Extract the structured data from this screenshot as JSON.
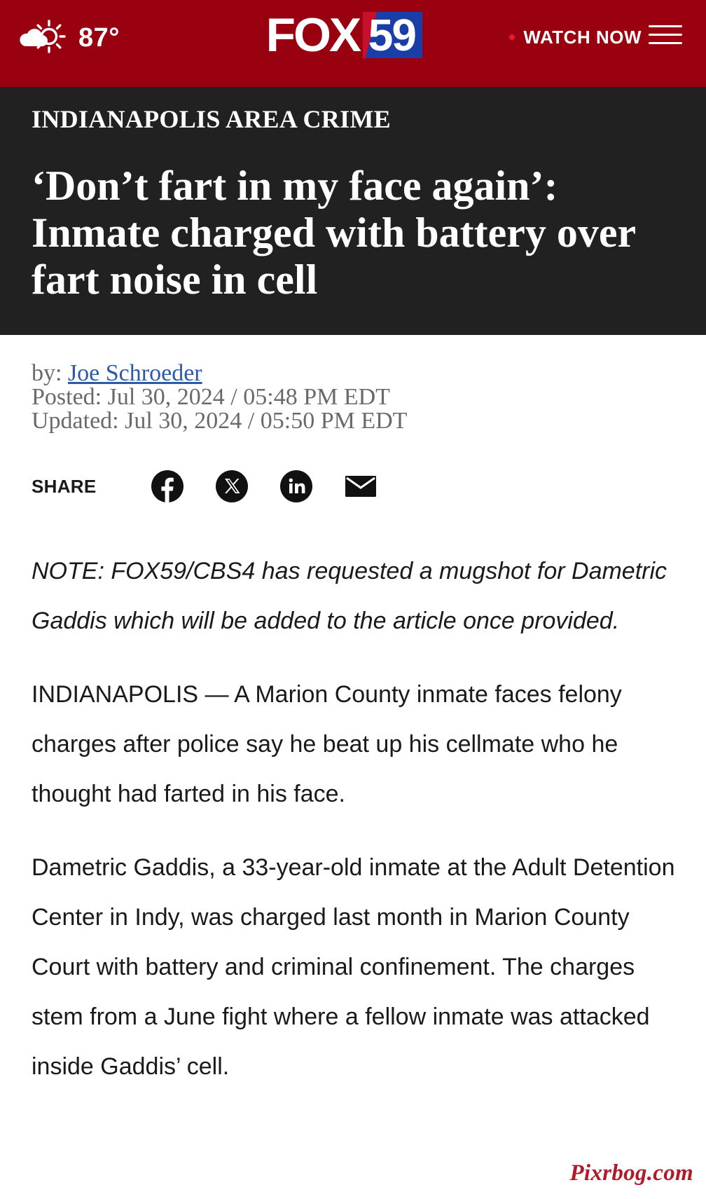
{
  "header": {
    "temperature": "87°",
    "weather_icon": "partly-sunny-icon",
    "logo_fox": "FOX",
    "logo_number": "59",
    "watch_label": "WATCH NOW",
    "menu_icon": "hamburger-menu-icon",
    "colors": {
      "bar": "#990010",
      "logo_blue": "#1a3ea8",
      "live_dot": "#e8192c"
    }
  },
  "article": {
    "category": "INDIANAPOLIS AREA CRIME",
    "headline": "‘Don’t fart in my face again’: Inmate charged with battery over fart noise in cell",
    "byline": {
      "by_label": "by:",
      "author": "Joe Schroeder",
      "posted": "Posted: Jul 30, 2024 / 05:48 PM EDT",
      "updated": "Updated: Jul 30, 2024 / 05:50 PM EDT"
    },
    "share": {
      "label": "SHARE",
      "icons": [
        "facebook-icon",
        "x-icon",
        "linkedin-icon",
        "email-icon"
      ]
    },
    "paragraphs": [
      "NOTE: FOX59/CBS4 has requested a mugshot for Dametric Gaddis which will be added to the article once provided.",
      "INDIANAPOLIS — A Marion County inmate faces felony charges after police say he beat up his cellmate who he thought had farted in his face.",
      "Dametric Gaddis, a 33-year-old inmate at the Adult Detention Center in Indy, was charged last month in Marion County Court with battery and criminal confinement. The charges stem from a June fight where a fellow inmate was attacked inside Gaddis’ cell."
    ]
  },
  "watermark": "Pixrbog.com"
}
